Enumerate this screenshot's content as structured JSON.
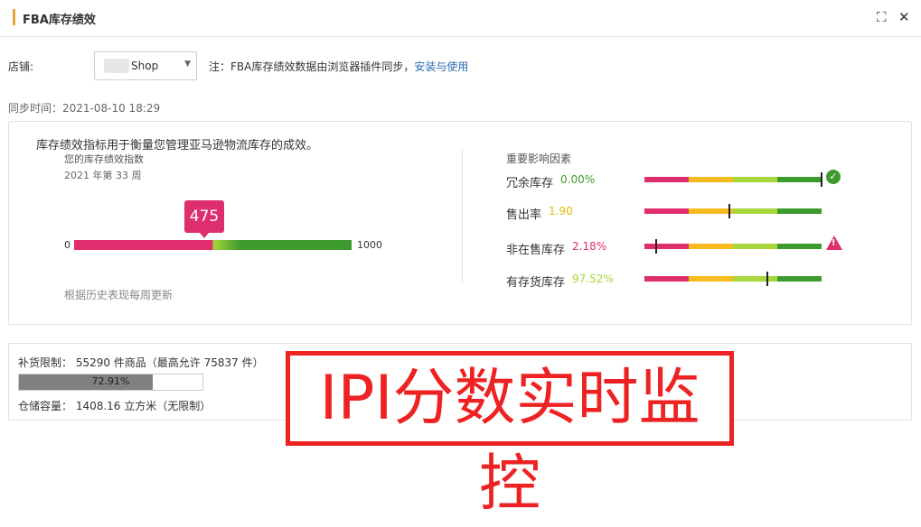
{
  "window": {
    "title": "FBA库存绩效",
    "maximize_icon": "⛶",
    "close_icon": "✕"
  },
  "shop": {
    "label": "店铺:",
    "selected": "Shop",
    "note_prefix": "注：FBA库存绩效数据由浏览器插件同步，",
    "note_link": "安装与使用"
  },
  "sync": {
    "text": "同步时间：2021-08-10 18:29"
  },
  "ipi": {
    "intro": "库存绩效指标用于衡量您管理亚马逊物流库存的成效。",
    "index_label": "您的库存绩效指数",
    "week": "2021 年第 33 周",
    "score": "475",
    "min": "0",
    "max": "1000",
    "update_note": "根据历史表现每周更新"
  },
  "factors": {
    "title": "重要影响因素",
    "items": [
      {
        "name": "冗余库存",
        "value": "0.00%",
        "color": "#3d9a2c",
        "status": "ok-icon"
      },
      {
        "name": "售出率",
        "value": "1.90",
        "color": "#e6b800",
        "status": ""
      },
      {
        "name": "非在售库存",
        "value": "2.18%",
        "color": "#de2e6e",
        "status": "warning-icon"
      },
      {
        "name": "有存货库存",
        "value": "97.52%",
        "color": "#a8d63c",
        "status": ""
      }
    ]
  },
  "capacity": {
    "replenish": "补货限制：  55290 件商品（最高允许 75837 件）",
    "progress_text": "72.91%",
    "progress_value": 72.91,
    "storage": "仓储容量：  1408.16 立方米（无限制）"
  },
  "overlay": {
    "text": "IPI分数实时监控"
  }
}
